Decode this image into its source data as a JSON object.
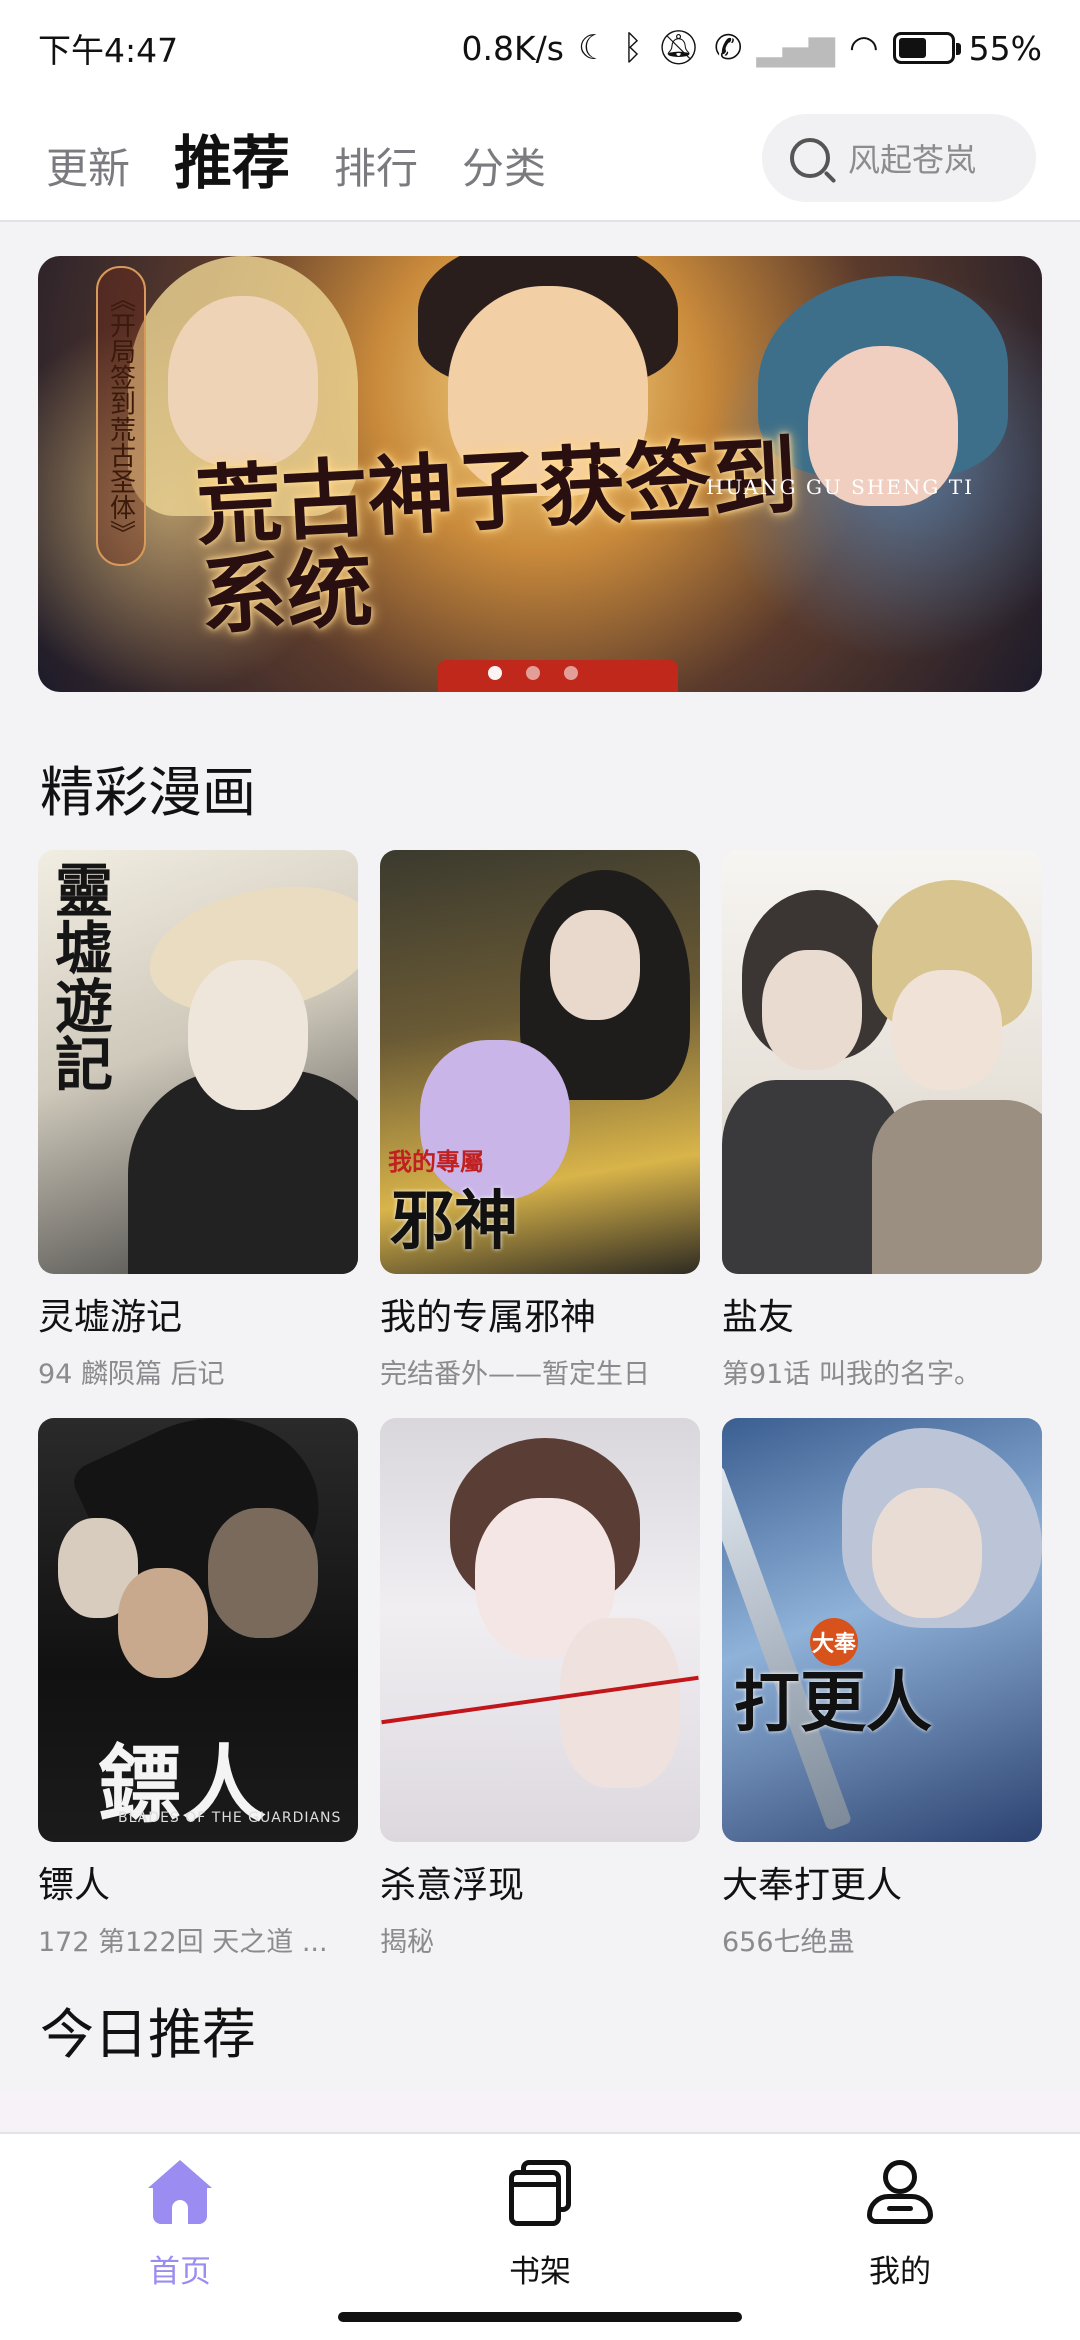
{
  "status_bar": {
    "time": "下午4:47",
    "net_speed": "0.8K/s",
    "battery_percent": "55%",
    "battery_level": 0.55,
    "icons": [
      "moon-icon",
      "bluetooth-icon",
      "mute-bell-icon",
      "call-icon",
      "signal-icon",
      "wifi-icon",
      "battery-icon"
    ]
  },
  "header": {
    "tabs": [
      {
        "label": "更新",
        "active": false
      },
      {
        "label": "推荐",
        "active": true
      },
      {
        "label": "排行",
        "active": false
      },
      {
        "label": "分类",
        "active": false
      }
    ],
    "search": {
      "placeholder": "风起苍岚",
      "icon": "search-icon"
    }
  },
  "banner": {
    "side_label": "《开局签到荒古圣体》",
    "title_art": "荒古神子获签到系统",
    "pinyin": "HUANG GU SHENG TI",
    "slide_count": 3,
    "active_slide": 0
  },
  "sections": {
    "featured_title": "精彩漫画",
    "today_title": "今日推荐"
  },
  "comics": [
    {
      "title": "灵墟游记",
      "subtitle": "94 麟陨篇 后记",
      "cover_text": "靈墟遊記"
    },
    {
      "title": "我的专属邪神",
      "subtitle": "完结番外——暂定生日",
      "cover_text": "邪神",
      "cover_small": "我的專屬"
    },
    {
      "title": "盐友",
      "subtitle": "第91话 叫我的名字。"
    },
    {
      "title": "镖人",
      "subtitle": "172 第122回 天之道 ...",
      "cover_text": "鏢人",
      "cover_small": "BLADES OF THE GUARDIANS"
    },
    {
      "title": "杀意浮现",
      "subtitle": "揭秘"
    },
    {
      "title": "大奉打更人",
      "subtitle": "656七绝蛊",
      "cover_text": "打更人",
      "cover_badge": "大奉"
    }
  ],
  "bottom_nav": [
    {
      "label": "首页",
      "icon": "home-icon",
      "active": true
    },
    {
      "label": "书架",
      "icon": "bookshelf-icon",
      "active": false
    },
    {
      "label": "我的",
      "icon": "user-icon",
      "active": false
    }
  ],
  "colors": {
    "accent": "#9a8cf0",
    "background": "#f3f3f5",
    "text_primary": "#111111",
    "text_secondary": "#8a8a8f"
  }
}
